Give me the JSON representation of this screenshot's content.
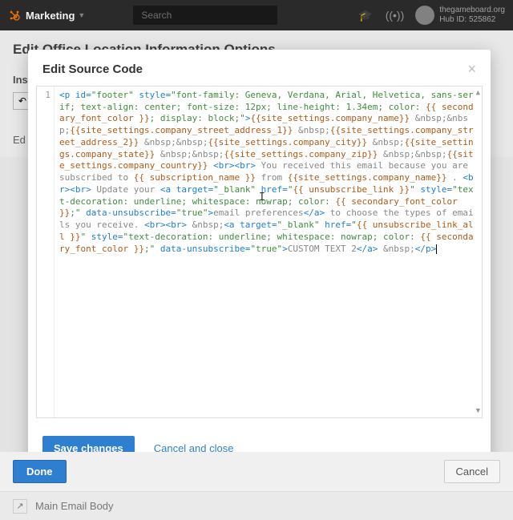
{
  "topnav": {
    "brand": "Marketing",
    "search_placeholder": "Search",
    "user_line1": "thegameboard.org",
    "user_line2": "Hub ID: 525862"
  },
  "bgpage": {
    "title": "Edit Office Location Information Options",
    "ins": "Ins",
    "ed": "Ed"
  },
  "modal": {
    "title": "Edit Source Code",
    "line_number": "1",
    "save_label": "Save changes",
    "cancel_label": "Cancel and close"
  },
  "code": {
    "s1": "<p id=",
    "q1": "\"footer\"",
    "s2": " style=",
    "q2": "\"font-family: Geneva, Verdana, Arial, Helvetica, sans-serif; text-align: center; font-size: 12px; line-height: 1.34em; color: ",
    "v1": "{{ secondary_font_color }}",
    "q3": "; display: block;\"",
    "s3": ">",
    "v2": "{{site_settings.company_name}}",
    "t1": " &nbsp;&nbsp;",
    "v3": "{{site_settings.company_street_address_1}}",
    "t2": " &nbsp;",
    "v4": "{{site_settings.company_street_address_2}}",
    "t3": " &nbsp;&nbsp;",
    "v5": "{{site_settings.company_city}}",
    "t4": " &nbsp;",
    "v6": "{{site_settings.company_state}}",
    "t5": " &nbsp;&nbsp;",
    "v7": "{{site_settings.company_zip}}",
    "t6": " &nbsp;&nbsp;",
    "v8": "{{site_settings.company_country}}",
    "s4": " <br><br>",
    "t7": " You received this email because you are subscribed to ",
    "v9": "{{ subscription_name }}",
    "t8": " from ",
    "v10": "{{site_settings.company_name}}",
    "t9": " . ",
    "s5": "<br><br>",
    "t10": " Update your ",
    "s6": "<a target=",
    "q4": "\"_blank\"",
    "s7": " href=",
    "q5": "\"",
    "v11": "{{ unsubscribe_link }}",
    "q5b": "\"",
    "s8": " style=",
    "q6": "\"text-decoration: underline; whitespace: nowrap; color: ",
    "v12": "{{ secondary_font_color }}",
    "q6b": ";\"",
    "s9": " data-unsubscribe=",
    "q7": "\"true\"",
    "s10": ">",
    "t11": "email preferences",
    "s11": "</a>",
    "t12": " to choose the types of emails you receive. ",
    "s12": "<br><br>",
    "t13": " &nbsp;",
    "s13": "<a target=",
    "q8": "\"_blank\"",
    "s14": " href=",
    "q9": "\"",
    "v13": "{{ unsubscribe_link_all }}",
    "q9b": "\"",
    "s15": " style=",
    "q10": "\"text-decoration: underline; whitespace: nowrap; color: ",
    "v14": "{{ secondary_font_color }}",
    "q10b": ";\"",
    "s16": " data-unsubscribe=",
    "q11": "\"true\"",
    "s17": ">",
    "t14": "CUSTOM TEXT 2",
    "s18": "</a>",
    "t15": " &nbsp;",
    "s19": "</p>"
  },
  "bottom": {
    "done": "Done",
    "cancel": "Cancel",
    "row_label": "Main Email Body"
  }
}
